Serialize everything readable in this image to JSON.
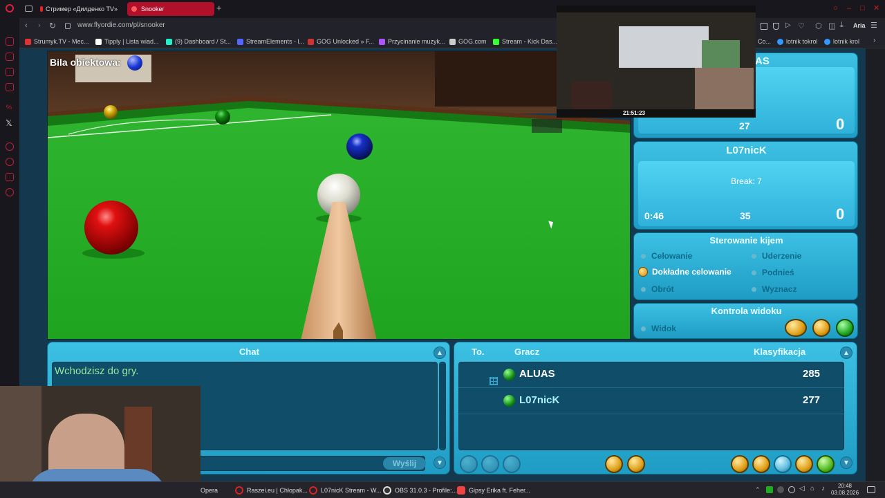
{
  "browser": {
    "tabs": [
      {
        "label": "Стример «Дилденко TV»"
      },
      {
        "label": "Snooker"
      }
    ],
    "new_tab": "+",
    "url": "www.flyordie.com/pl/snooker",
    "aria_label": "Aria",
    "bookmarks": [
      {
        "label": "Strumyk.TV - Mec...",
        "color": "#d33"
      },
      {
        "label": "Tipply | Lista wiad...",
        "color": "#fff"
      },
      {
        "label": "(9) Dashboard / St...",
        "color": "#2ec"
      },
      {
        "label": "StreamElements - l...",
        "color": "#56f"
      },
      {
        "label": "GOG Unlocked » F...",
        "color": "#c33"
      },
      {
        "label": "Przycinanie muzyk...",
        "color": "#a5f"
      },
      {
        "label": "GOG.com",
        "color": "#ccc"
      },
      {
        "label": "Stream - Kick Das...",
        "color": "#3f3"
      },
      {
        "label": "Co...",
        "color": "#888"
      },
      {
        "label": "lotnik tokrol",
        "color": "#39f"
      },
      {
        "label": "lotnik krol",
        "color": "#39f"
      }
    ]
  },
  "game": {
    "object_ball_label": "Bila obiektowa:",
    "object_ball_color": "#1a3ad6",
    "player1": {
      "name_partial": "AS",
      "break_partial": "27",
      "score": "0"
    },
    "player2": {
      "name": "L07nicK",
      "break_label": "Break: 7",
      "timer": "0:46",
      "remaining": "35",
      "score": "0"
    },
    "cue_control": {
      "title": "Sterowanie kijem",
      "options": [
        {
          "label": "Celowanie",
          "selected": false
        },
        {
          "label": "Uderzenie",
          "selected": false
        },
        {
          "label": "Dokładne celowanie",
          "selected": true
        },
        {
          "label": "Podnieś",
          "selected": false
        },
        {
          "label": "Obrót",
          "selected": false
        },
        {
          "label": "Wyznacz",
          "selected": false
        }
      ]
    },
    "view_control": {
      "title": "Kontrola widoku",
      "option": "Widok"
    },
    "chat": {
      "title": "Chat",
      "message": "Wchodzisz do gry.",
      "send_label": "Wyślij"
    },
    "ranking": {
      "col_to": "To.",
      "col_player": "Gracz",
      "col_rank": "Klasyfikacja",
      "rows": [
        {
          "name": "ALUAS",
          "score": "285",
          "name_color": "#ffffff"
        },
        {
          "name": "L07nicK",
          "score": "277",
          "name_color": "#aef2ff"
        }
      ]
    }
  },
  "overlay": {
    "time": "21:51:23"
  },
  "taskbar": {
    "items": [
      {
        "label": "Opera",
        "color": "#d22"
      },
      {
        "label": "Raszei.eu | Chłopak...",
        "color": "#d22"
      },
      {
        "label": "L07nicK Stream - W...",
        "color": "#d22"
      },
      {
        "label": "OBS 31.0.3 - Profile:...",
        "color": "#333"
      },
      {
        "label": "Gipsy Erika ft. Feher...",
        "color": "#e44"
      }
    ],
    "time": "20:48",
    "date": "03.08.2026"
  }
}
